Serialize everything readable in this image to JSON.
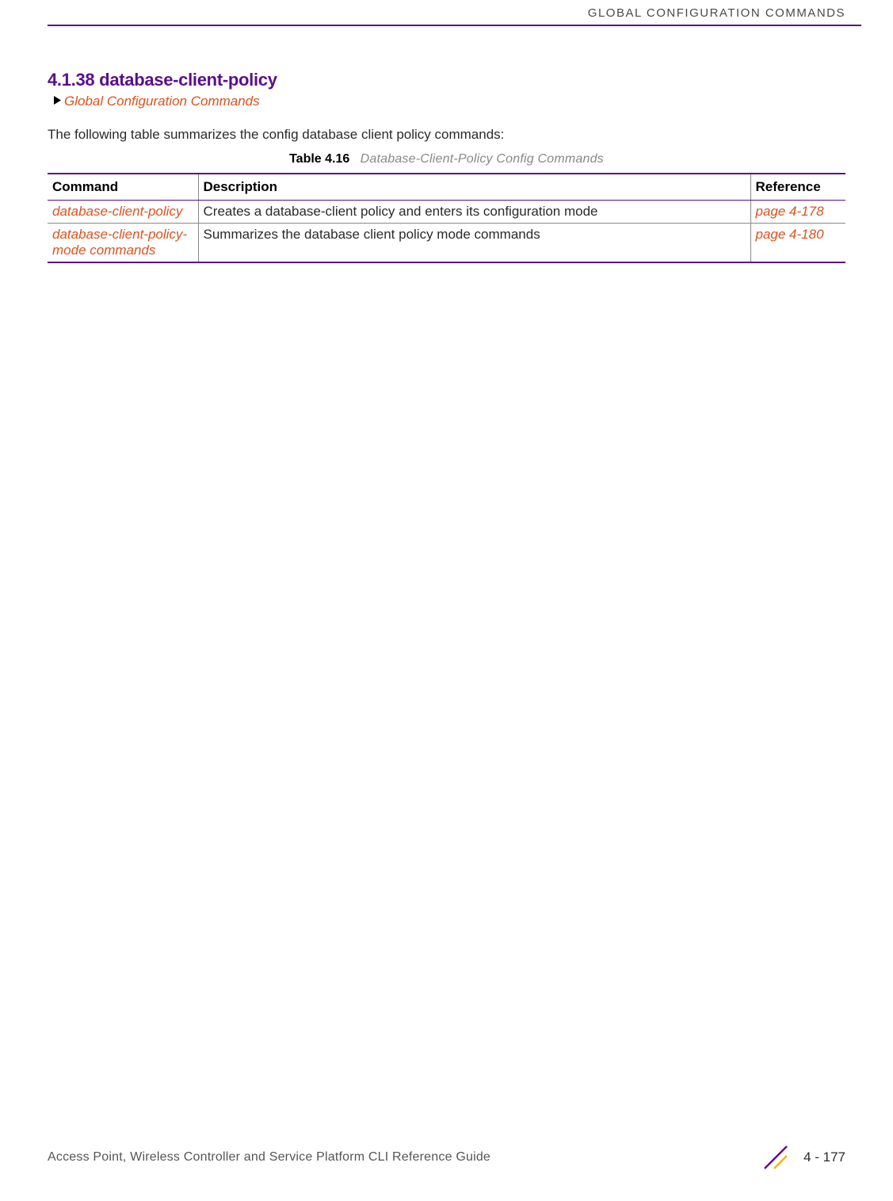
{
  "header": {
    "running_title": "GLOBAL CONFIGURATION COMMANDS"
  },
  "section": {
    "heading": "4.1.38 database-client-policy",
    "breadcrumb_link": "Global Configuration Commands",
    "intro": "The following table summarizes the config database client policy commands:"
  },
  "table": {
    "caption_label": "Table 4.16",
    "caption_title": "Database-Client-Policy Config Commands",
    "headers": {
      "command": "Command",
      "description": "Description",
      "reference": "Reference"
    },
    "rows": [
      {
        "command": "database-client-policy",
        "description": "Creates a database-client policy and enters its configuration mode",
        "reference": "page 4-178"
      },
      {
        "command": "database-client-policy-mode commands",
        "description": "Summarizes the database client policy mode commands",
        "reference": "page 4-180"
      }
    ]
  },
  "footer": {
    "doc_title": "Access Point, Wireless Controller and Service Platform CLI Reference Guide",
    "page_number": "4 - 177"
  }
}
